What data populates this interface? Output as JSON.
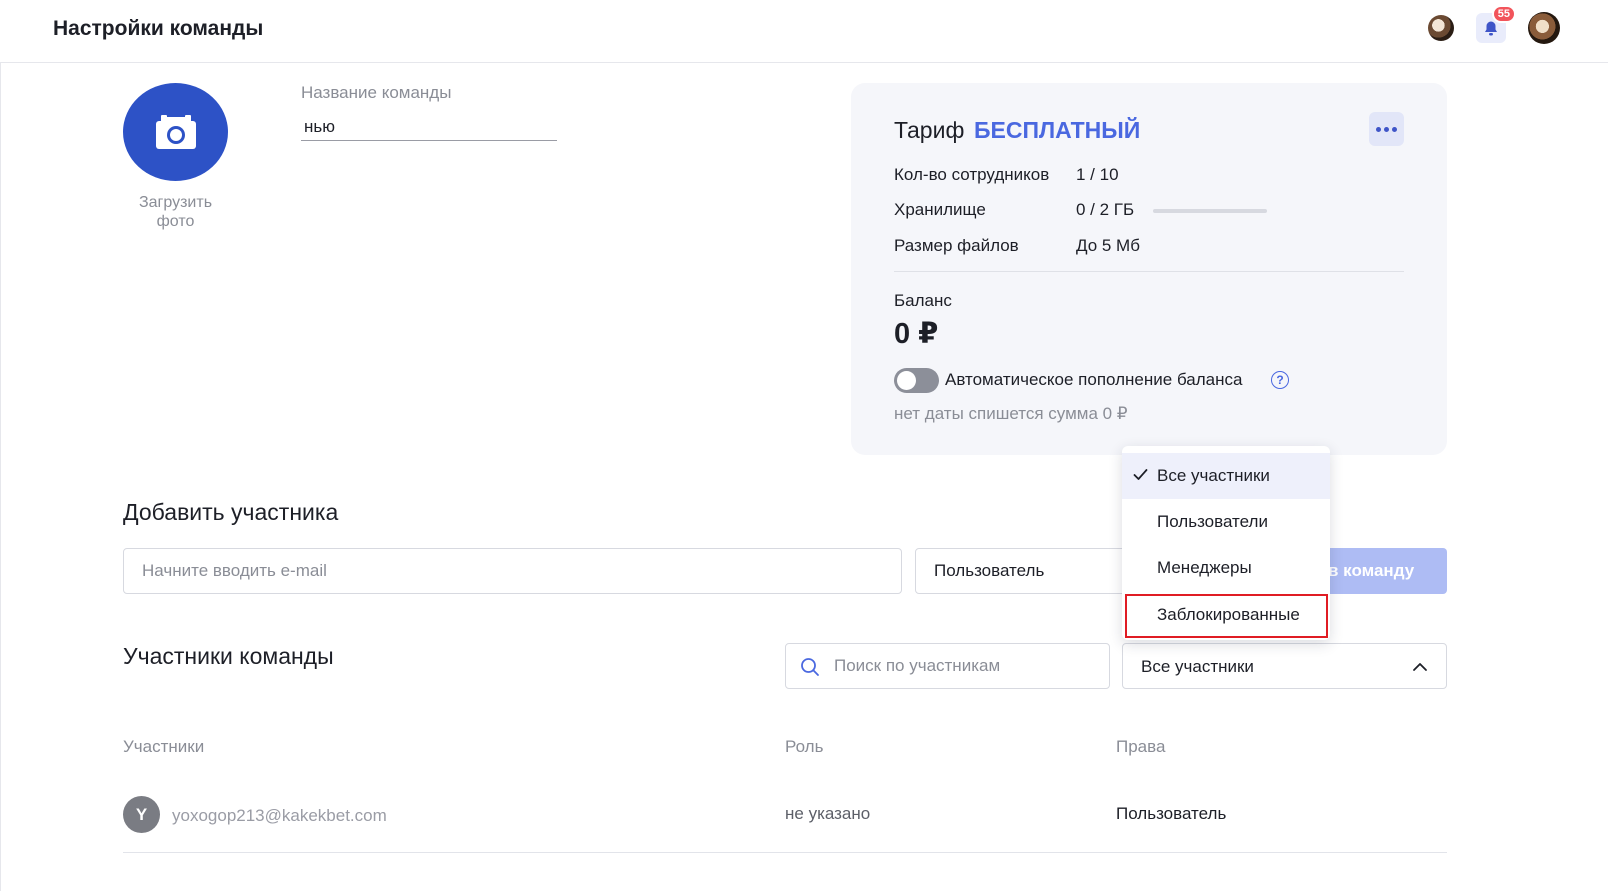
{
  "header": {
    "title": "Настройки команды",
    "notification_count": "55"
  },
  "team": {
    "upload_label": "Загрузить фото",
    "name_label": "Название команды",
    "name_value": "нью"
  },
  "tariff": {
    "title": "Тариф",
    "plan": "БЕСПЛАТНЫЙ",
    "rows": [
      {
        "label": "Кол-во сотрудников",
        "value": "1 / 10"
      },
      {
        "label": "Хранилище",
        "value": "0 / 2 ГБ"
      },
      {
        "label": "Размер файлов",
        "value": "До 5 Мб"
      }
    ],
    "storage_used_fraction": 0,
    "balance_label": "Баланс",
    "balance_value": "0 ₽",
    "auto_topup_label": "Автоматическое пополнение баланса",
    "auto_topup_enabled": false,
    "auto_topup_note": "нет даты спишется сумма 0 ₽"
  },
  "add_member": {
    "title": "Добавить участника",
    "email_placeholder": "Начните вводить e-mail",
    "role_value": "Пользователь",
    "button_label": "в команду"
  },
  "members": {
    "title": "Участники команды",
    "search_placeholder": "Поиск по участникам",
    "filter_value": "Все участники",
    "columns": [
      "Участники",
      "Роль",
      "Права"
    ],
    "rows": [
      {
        "initial": "Y",
        "email": "yoxogop213@kakekbet.com",
        "role": "не указано",
        "rights": "Пользователь"
      }
    ]
  },
  "filter_dropdown": {
    "options": [
      "Все участники",
      "Пользователи",
      "Менеджеры",
      "Заблокированные"
    ],
    "selected": "Все участники",
    "highlighted": "Заблокированные"
  },
  "colors": {
    "accent": "#4a68e0",
    "photo_circle": "#2d52c6",
    "badge": "#f2545b",
    "highlight": "#e01c24"
  }
}
